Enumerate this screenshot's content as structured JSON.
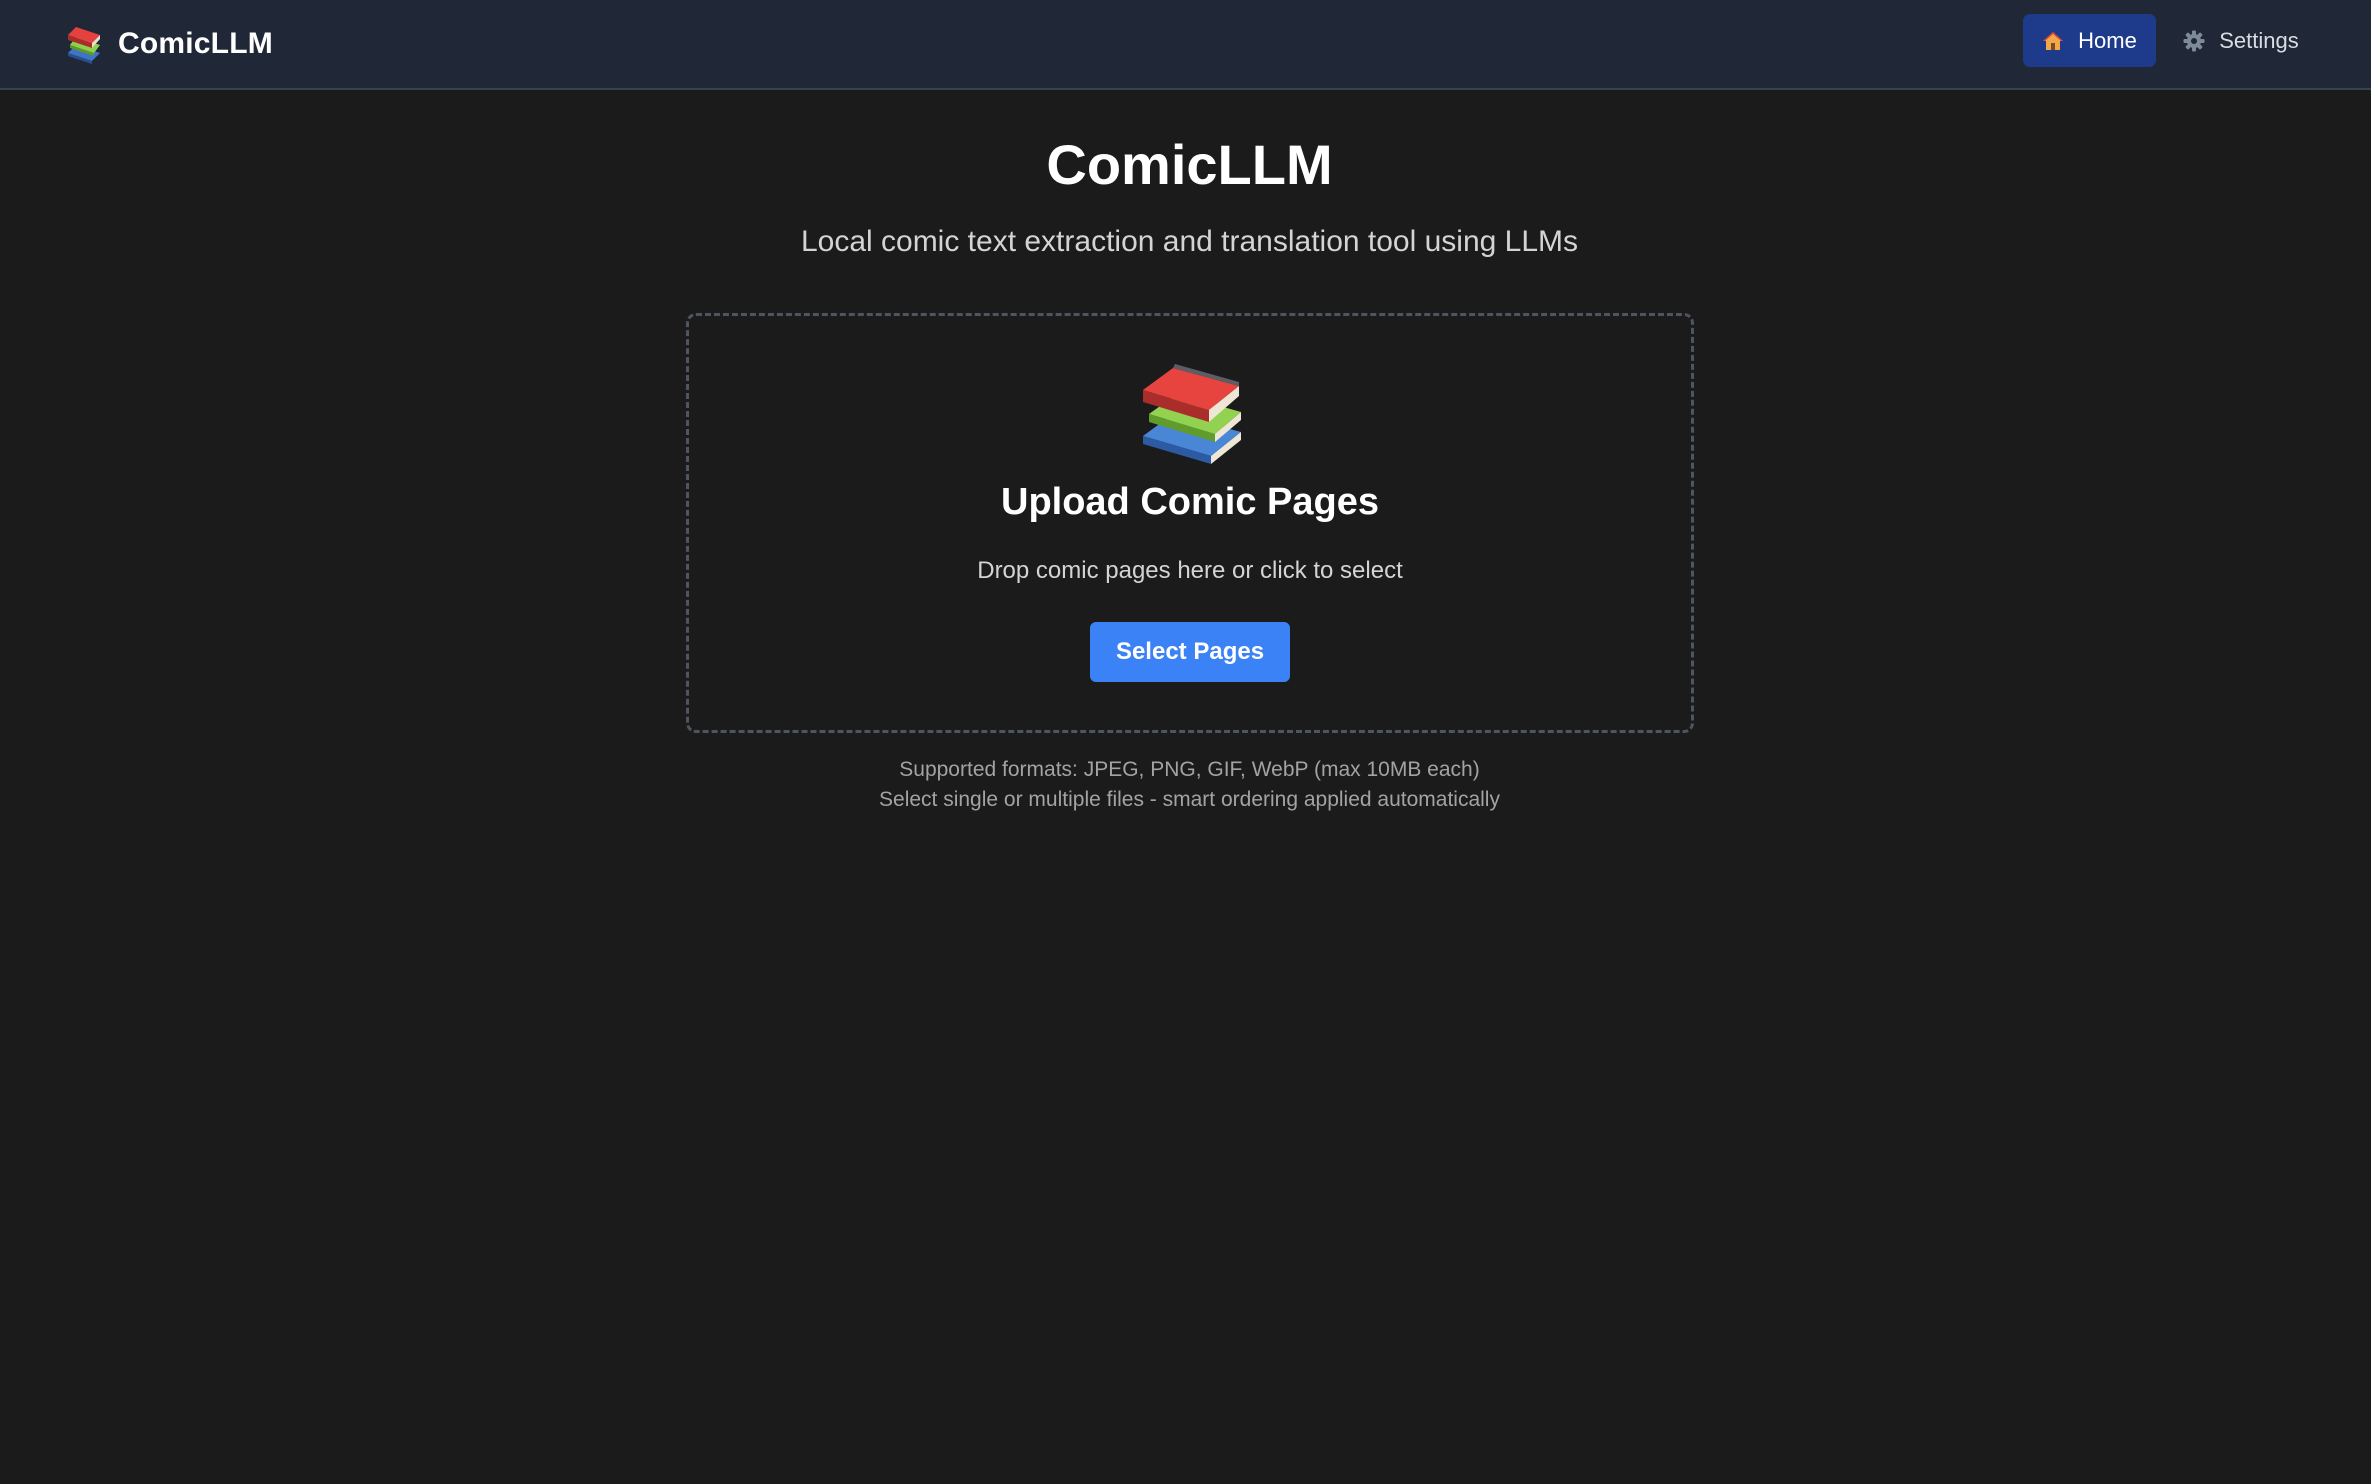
{
  "navbar": {
    "brand": {
      "name": "ComicLLM",
      "icon": "books-icon"
    },
    "links": [
      {
        "label": "Home",
        "icon": "house-icon",
        "active": true
      },
      {
        "label": "Settings",
        "icon": "gear-icon",
        "active": false
      }
    ]
  },
  "hero": {
    "title": "ComicLLM",
    "subtitle": "Local comic text extraction and translation tool using LLMs"
  },
  "upload": {
    "icon": "books-icon",
    "title": "Upload Comic Pages",
    "instruction": "Drop comic pages here or click to select",
    "button_label": "Select Pages"
  },
  "hints": {
    "formats": "Supported formats: JPEG, PNG, GIF, WebP (max 10MB each)",
    "multi": "Select single or multiple files - smart ordering applied automatically"
  },
  "colors": {
    "background": "#1b1b1b",
    "navbar": "#202838",
    "active_nav": "#1e3a8a",
    "accent": "#3b82f6"
  }
}
